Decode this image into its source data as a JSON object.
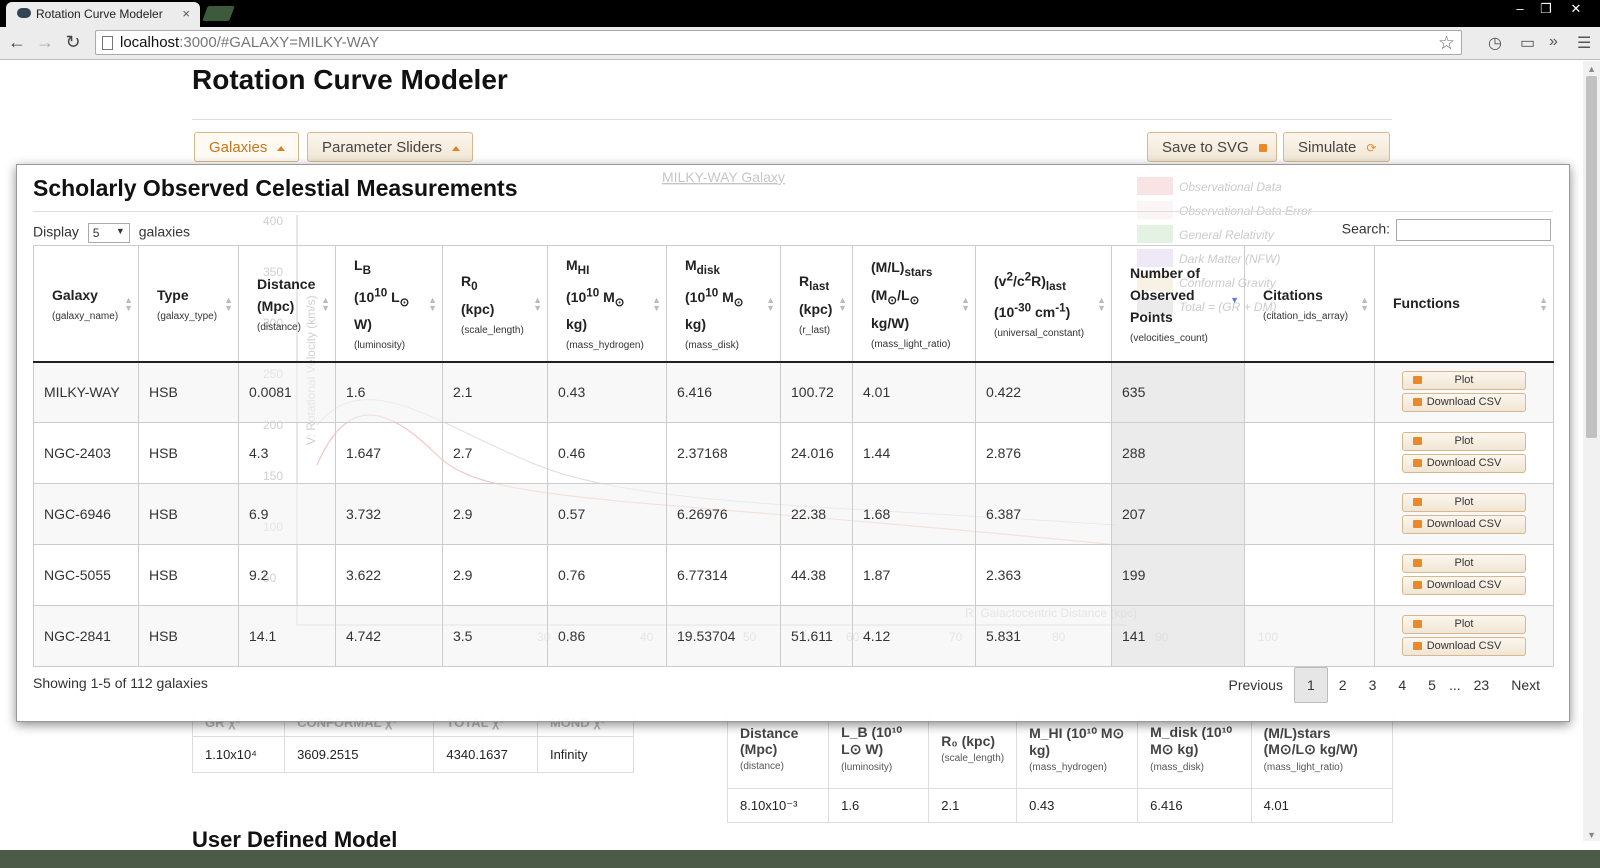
{
  "browser": {
    "tab_title": "Rotation Curve Modeler",
    "tab_close": "×",
    "url_host": "localhost",
    "url_path": ":3000/#GALAXY=MILKY-WAY",
    "win_min": "–",
    "win_restore": "❐",
    "win_close": "✕"
  },
  "page": {
    "title": "Rotation Curve Modeler",
    "galaxies_button": "Galaxies",
    "sliders_button": "Parameter Sliders",
    "save_button": "Save to SVG",
    "simulate_button": "Simulate",
    "user_defined_model": "User Defined Model"
  },
  "chart_ghost": {
    "title": "MILKY-WAY Galaxy",
    "legend": [
      "Observational Data",
      "Observational Data Error",
      "General Relativity",
      "Dark Matter (NFW)",
      "Conformal Gravity",
      "Total = (GR + DM)"
    ],
    "ylabel": "V: Rotational Velocity (km/s)",
    "xlabel": "R: Galactocentric Distance (kpc)",
    "y_ticks": [
      "400",
      "350",
      "300",
      "250",
      "200",
      "150",
      "100",
      "50"
    ],
    "x_ticks": [
      "30",
      "40",
      "50",
      "60",
      "70",
      "80",
      "90",
      "100"
    ]
  },
  "chi_table": {
    "headers": [
      "GR χ²",
      "CONFORMAL χ²",
      "TOTAL χ²",
      "MOND χ²"
    ],
    "values": [
      "1.10x10⁴",
      "3609.2515",
      "4340.1637",
      "Infinity"
    ]
  },
  "param_table": {
    "headers": [
      {
        "label": "Distance (Mpc)",
        "field": "(distance)"
      },
      {
        "label": "L_B (10¹⁰ L⊙ W)",
        "field": "(luminosity)"
      },
      {
        "label": "R₀ (kpc)",
        "field": "(scale_length)"
      },
      {
        "label": "M_HI (10¹⁰ M⊙ kg)",
        "field": "(mass_hydrogen)"
      },
      {
        "label": "M_disk (10¹⁰ M⊙ kg)",
        "field": "(mass_disk)"
      },
      {
        "label": "(M/L)stars (M⊙/L⊙ kg/W)",
        "field": "(mass_light_ratio)"
      }
    ],
    "values": [
      "8.10x10⁻³",
      "1.6",
      "2.1",
      "0.43",
      "6.416",
      "4.01"
    ]
  },
  "modal": {
    "title": "Scholarly Observed Celestial Measurements",
    "display_prefix": "Display",
    "display_value": "5",
    "display_suffix": "galaxies",
    "search_label": "Search:",
    "search_value": "",
    "columns": [
      {
        "label": "Galaxy",
        "field": "(galaxy_name)"
      },
      {
        "label": "Type",
        "field": "(galaxy_type)"
      },
      {
        "label": "Distance (Mpc)",
        "field": "(distance)"
      },
      {
        "label": "L_B (10^10 L_⊙ W)",
        "field": "(luminosity)"
      },
      {
        "label": "R_0 (kpc)",
        "field": "(scale_length)"
      },
      {
        "label": "M_HI (10^10 M_⊙ kg)",
        "field": "(mass_hydrogen)"
      },
      {
        "label": "M_disk (10^10 M_⊙ kg)",
        "field": "(mass_disk)"
      },
      {
        "label": "R_last (kpc)",
        "field": "(r_last)"
      },
      {
        "label": "(M/L)_stars (M_⊙/L_⊙ kg/W)",
        "field": "(mass_light_ratio)"
      },
      {
        "label": "(v^2/c^2R)_last (10^-30 cm^-1)",
        "field": "(universal_constant)"
      },
      {
        "label": "Number of Observed Points",
        "field": "(velocities_count)"
      },
      {
        "label": "Citations",
        "field": "(citation_ids_array)"
      },
      {
        "label": "Functions",
        "field": ""
      }
    ],
    "rows": [
      [
        "MILKY-WAY",
        "HSB",
        "0.0081",
        "1.6",
        "2.1",
        "0.43",
        "6.416",
        "100.72",
        "4.01",
        "0.422",
        "635",
        ""
      ],
      [
        "NGC-2403",
        "HSB",
        "4.3",
        "1.647",
        "2.7",
        "0.46",
        "2.37168",
        "24.016",
        "1.44",
        "2.876",
        "288",
        ""
      ],
      [
        "NGC-6946",
        "HSB",
        "6.9",
        "3.732",
        "2.9",
        "0.57",
        "6.26976",
        "22.38",
        "1.68",
        "6.387",
        "207",
        ""
      ],
      [
        "NGC-5055",
        "HSB",
        "9.2",
        "3.622",
        "2.9",
        "0.76",
        "6.77314",
        "44.38",
        "1.87",
        "2.363",
        "199",
        ""
      ],
      [
        "NGC-2841",
        "HSB",
        "14.1",
        "4.742",
        "3.5",
        "0.86",
        "19.53704",
        "51.611",
        "4.12",
        "5.831",
        "141",
        ""
      ]
    ],
    "plot_button": "Plot",
    "download_button": "Download CSV",
    "showing_text": "Showing 1-5 of 112 galaxies",
    "pager": {
      "previous": "Previous",
      "pages": [
        "1",
        "2",
        "3",
        "4",
        "5"
      ],
      "current": "1",
      "ellipsis": "...",
      "last": "23",
      "next": "Next"
    }
  }
}
